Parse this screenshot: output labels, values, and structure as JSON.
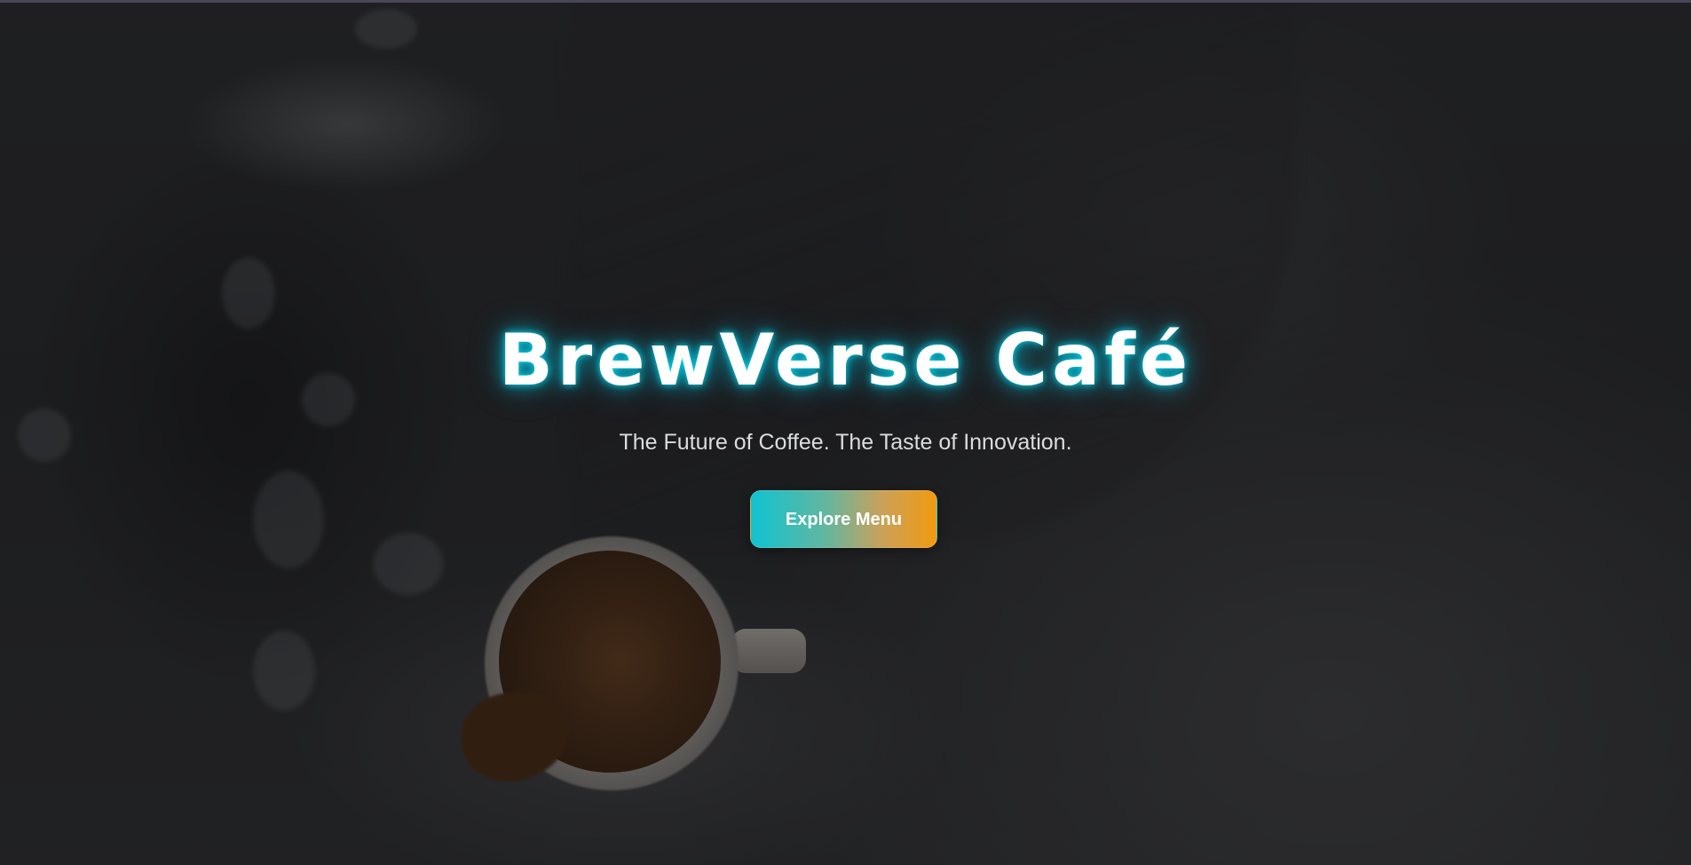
{
  "hero": {
    "title": "BrewVerse Café",
    "subtitle": "The Future of Coffee. The Taste of Innovation.",
    "cta_label": "Explore Menu"
  },
  "colors": {
    "title_glow": "#00e6ff",
    "cta_gradient_start": "#0fc3d1",
    "cta_gradient_end": "#f29a0e",
    "subtitle_text": "#dcdcdc"
  }
}
